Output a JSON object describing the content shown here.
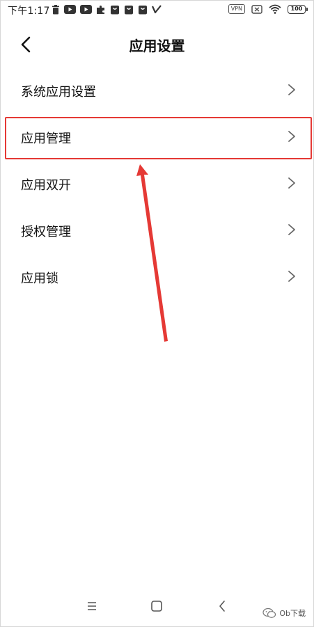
{
  "status_bar": {
    "time": "下午1:17",
    "vpn_label": "VPN",
    "battery_level": "100"
  },
  "header": {
    "title": "应用设置"
  },
  "settings": {
    "items": [
      {
        "label": "系统应用设置"
      },
      {
        "label": "应用管理"
      },
      {
        "label": "应用双开"
      },
      {
        "label": "授权管理"
      },
      {
        "label": "应用锁"
      }
    ]
  },
  "annotation": {
    "highlighted_item": "应用管理",
    "color": "#e53935"
  },
  "watermark": {
    "text": "Ob下载"
  }
}
